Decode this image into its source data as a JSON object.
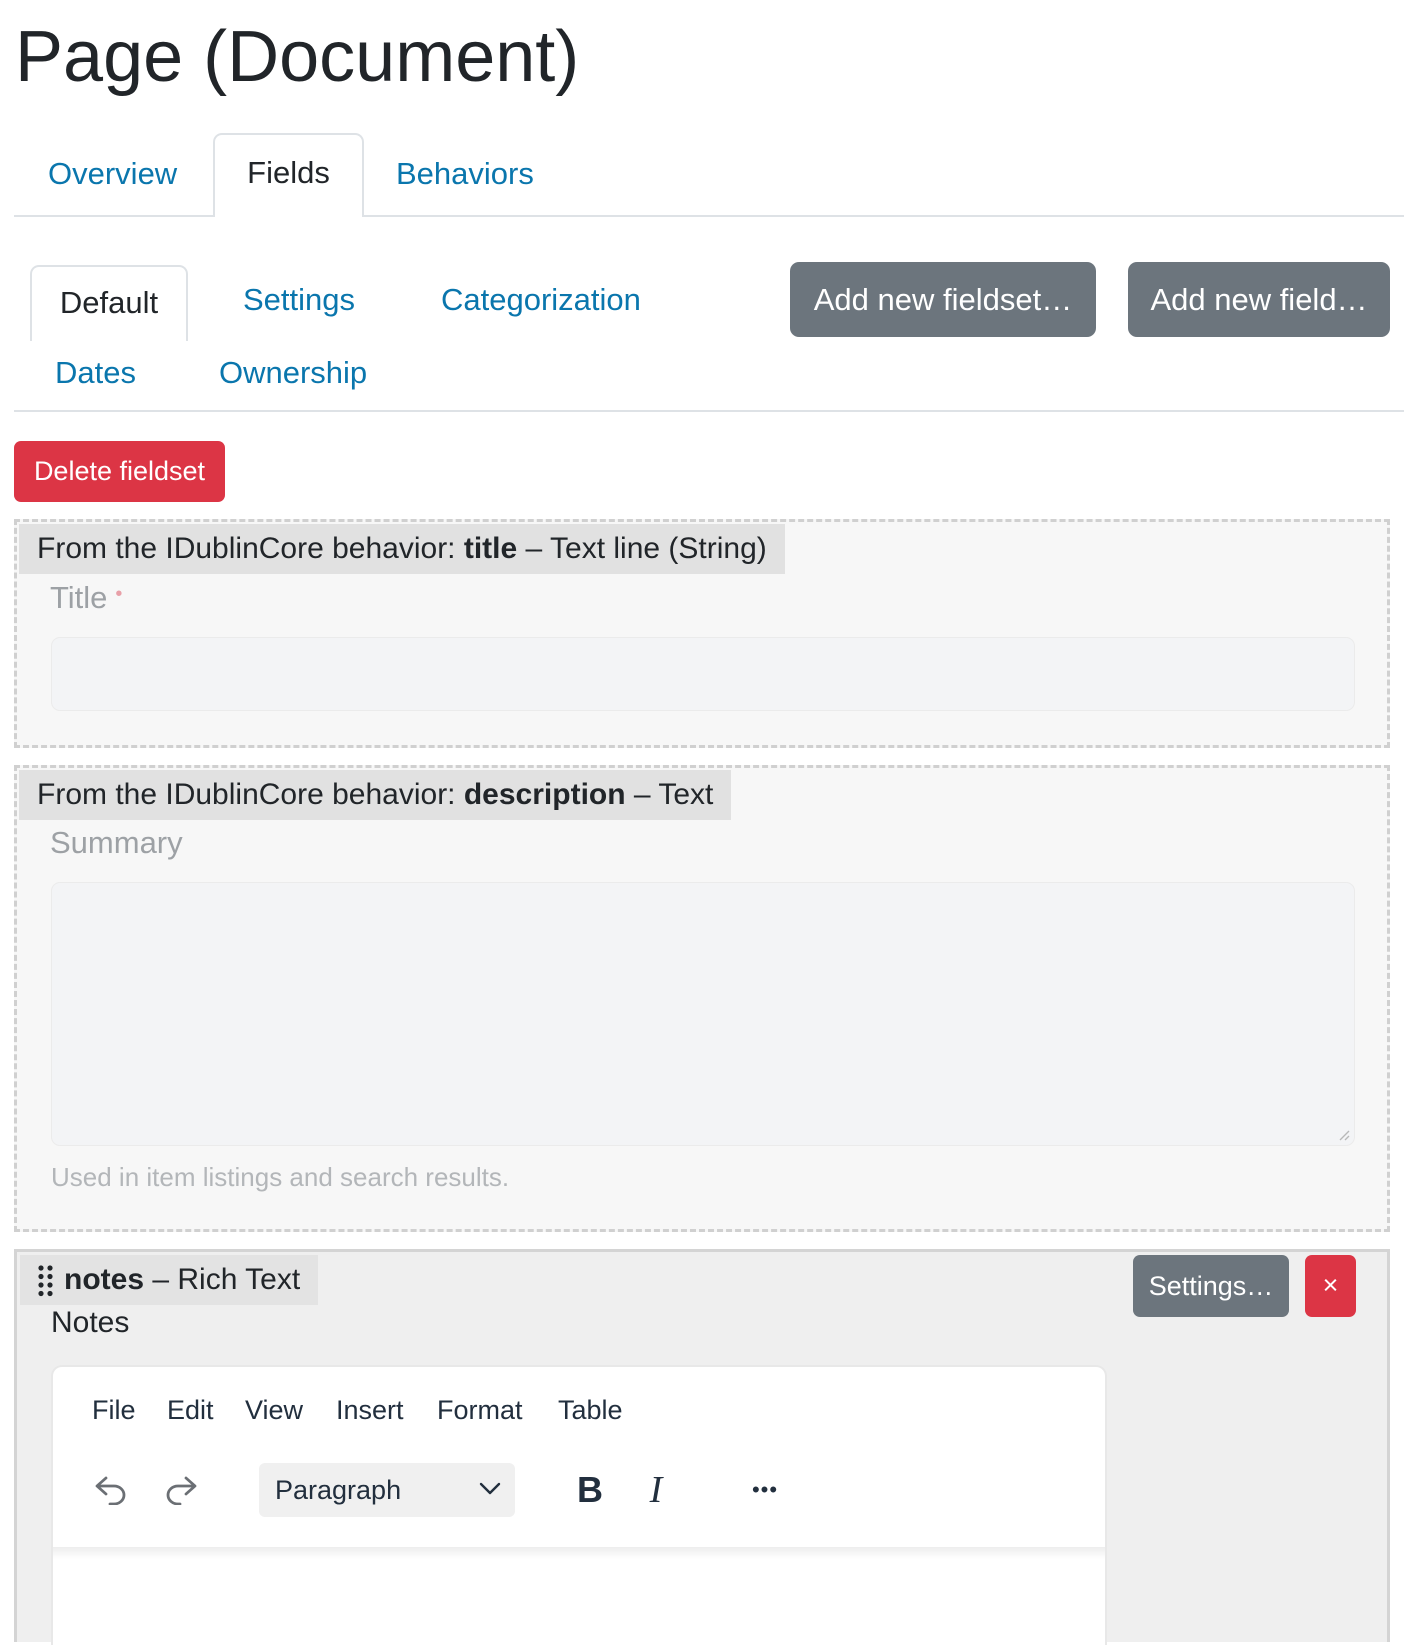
{
  "page_title": "Page (Document)",
  "top_tabs": {
    "overview": "Overview",
    "fields": "Fields",
    "behaviors": "Behaviors"
  },
  "fieldset_tabs": {
    "default": "Default",
    "settings": "Settings",
    "categorization": "Categorization",
    "dates": "Dates",
    "ownership": "Ownership"
  },
  "buttons": {
    "add_fieldset": "Add new fieldset…",
    "add_field": "Add new field…",
    "delete_fieldset": "Delete fieldset"
  },
  "fields": {
    "title_field": {
      "prefix": "From the IDublinCore behavior: ",
      "name": "title",
      "type": " – Text line (String)",
      "label": "Title",
      "required_marker": "•"
    },
    "description_field": {
      "prefix": "From the IDublinCore behavior: ",
      "name": "description",
      "type": " – Text",
      "label": "Summary",
      "help": "Used in item listings and search results."
    },
    "notes_field": {
      "name": "notes",
      "type": " – Rich Text",
      "label": "Notes",
      "settings_button": "Settings…",
      "remove_button": "×"
    }
  },
  "editor": {
    "menu": [
      "File",
      "Edit",
      "View",
      "Insert",
      "Format",
      "Table"
    ],
    "block_format": "Paragraph",
    "bold": "B",
    "italic": "I",
    "more": "•••"
  },
  "colors": {
    "link": "#0a76ad",
    "secondary_button": "#6c757d",
    "danger_button": "#dc3545",
    "text": "#212529"
  }
}
